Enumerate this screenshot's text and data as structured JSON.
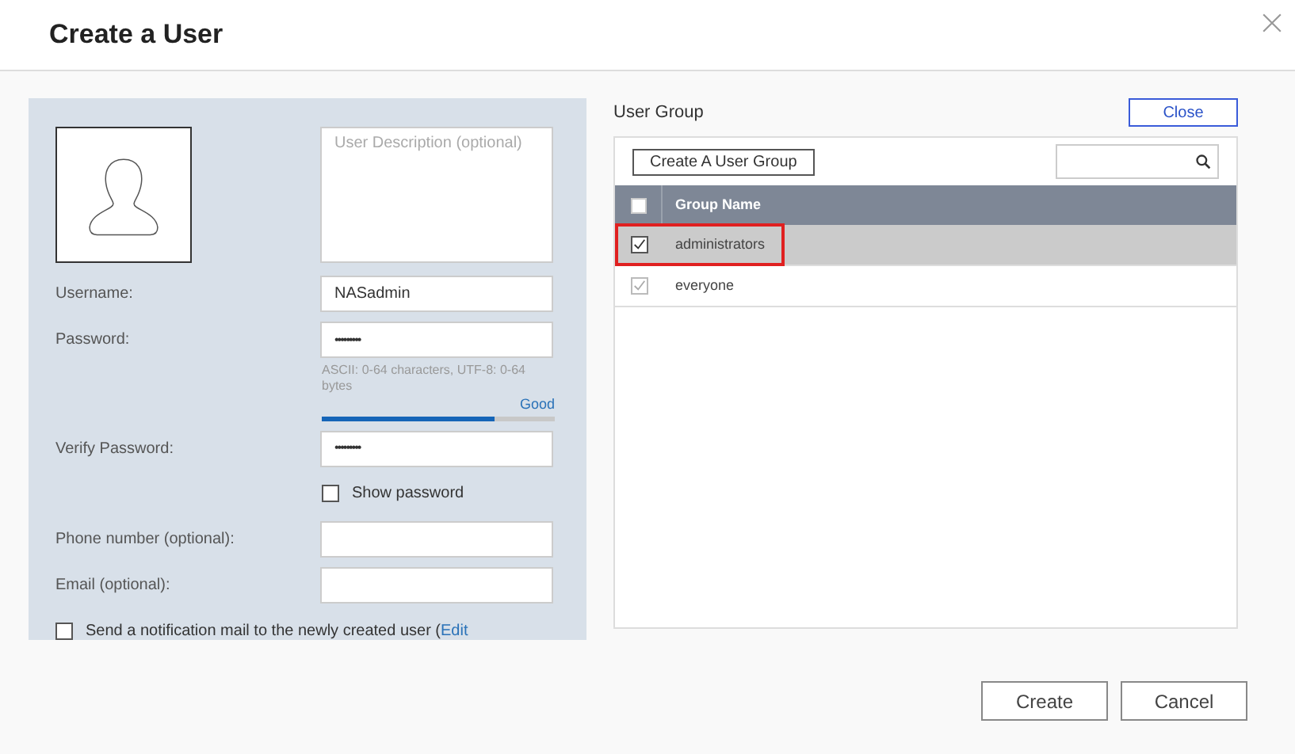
{
  "window": {
    "title": "Create a User"
  },
  "form": {
    "description": {
      "placeholder": "User Description (optional)"
    },
    "fields": [
      {
        "kind": "text",
        "label": "Username:",
        "value": "NASadmin"
      },
      {
        "kind": "password",
        "label": "Password:",
        "value": "•••••••••",
        "hint": "ASCII: 0-64 characters, UTF-8: 0-64 bytes",
        "strength": "Good",
        "level": 0.74
      },
      {
        "kind": "password",
        "label": "Verify Password:",
        "value": "•••••••••"
      },
      {
        "kind": "checkbox",
        "label": "Show password",
        "checked": false
      },
      {
        "kind": "text",
        "label": "Phone number (optional):"
      },
      {
        "kind": "text",
        "label": "Email (optional):"
      }
    ],
    "notify": {
      "label": "Send a notification mail to the newly created user (",
      "link": "Edit",
      "checked": false
    }
  },
  "user_group": {
    "title": "User Group",
    "close": "Close",
    "create_group": "Create A User Group",
    "column": "Group Name",
    "all_checked": false,
    "rows": [
      {
        "name": "administrators",
        "checked": true,
        "disabled": false,
        "selected": true,
        "highlighted": true
      },
      {
        "name": "everyone",
        "checked": true,
        "disabled": true,
        "selected": false,
        "highlighted": false
      }
    ]
  },
  "buttons": [
    "Create",
    "Cancel"
  ]
}
